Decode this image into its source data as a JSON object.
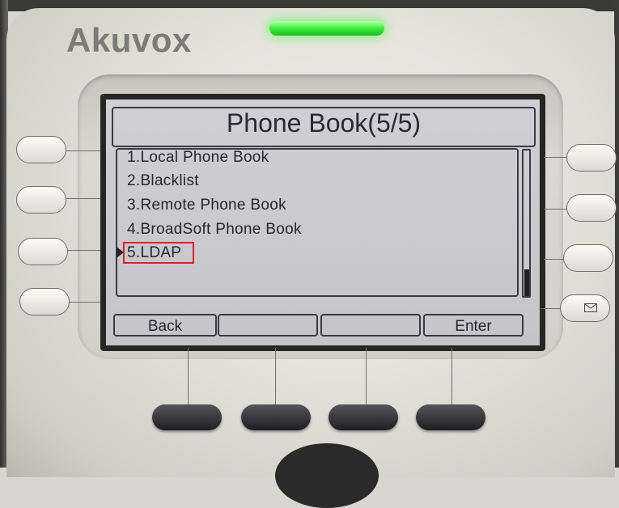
{
  "brand": "Akuvox",
  "screen": {
    "title": "Phone Book(5/5)",
    "items": [
      {
        "label": "1.Local Phone Book"
      },
      {
        "label": "2.Blacklist"
      },
      {
        "label": "3.Remote Phone Book"
      },
      {
        "label": "4.BroadSoft Phone Book"
      },
      {
        "label": "5.LDAP"
      }
    ],
    "selected_index": 5,
    "softkeys": [
      "Back",
      "",
      "",
      "Enter"
    ]
  },
  "icons": {
    "right_bottom_button": "mail-icon"
  },
  "colors": {
    "led": "#3cf03a",
    "highlight": "#e0202a",
    "lcd_background": "#c9c8cc"
  }
}
